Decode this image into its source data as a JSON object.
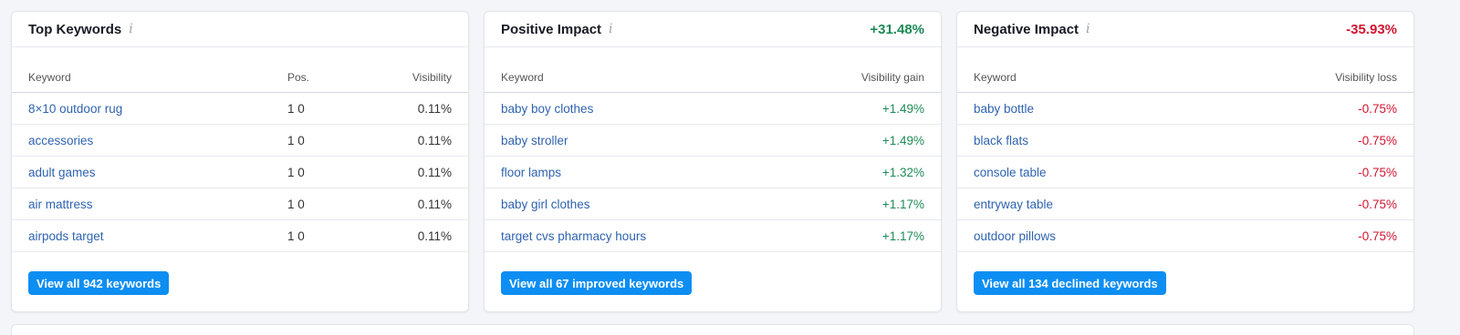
{
  "top": {
    "title": "Top Keywords",
    "info_icon": "i",
    "headers": {
      "keyword": "Keyword",
      "pos": "Pos.",
      "visibility": "Visibility"
    },
    "rows": [
      {
        "keyword": "8×10 outdoor rug",
        "pos": "1 0",
        "value": "0.11%"
      },
      {
        "keyword": "accessories",
        "pos": "1 0",
        "value": "0.11%"
      },
      {
        "keyword": "adult games",
        "pos": "1 0",
        "value": "0.11%"
      },
      {
        "keyword": "air mattress",
        "pos": "1 0",
        "value": "0.11%"
      },
      {
        "keyword": "airpods target",
        "pos": "1 0",
        "value": "0.11%"
      }
    ],
    "button": "View all 942 keywords"
  },
  "positive": {
    "title": "Positive Impact",
    "info_icon": "i",
    "delta": "+31.48%",
    "headers": {
      "keyword": "Keyword",
      "value": "Visibility gain"
    },
    "rows": [
      {
        "keyword": "baby boy clothes",
        "value": "+1.49%"
      },
      {
        "keyword": "baby stroller",
        "value": "+1.49%"
      },
      {
        "keyword": "floor lamps",
        "value": "+1.32%"
      },
      {
        "keyword": "baby girl clothes",
        "value": "+1.17%"
      },
      {
        "keyword": "target cvs pharmacy hours",
        "value": "+1.17%"
      }
    ],
    "button": "View all 67 improved keywords"
  },
  "negative": {
    "title": "Negative Impact",
    "info_icon": "i",
    "delta": "-35.93%",
    "headers": {
      "keyword": "Keyword",
      "value": "Visibility loss"
    },
    "rows": [
      {
        "keyword": "baby bottle",
        "value": "-0.75%"
      },
      {
        "keyword": "black flats",
        "value": "-0.75%"
      },
      {
        "keyword": "console table",
        "value": "-0.75%"
      },
      {
        "keyword": "entryway table",
        "value": "-0.75%"
      },
      {
        "keyword": "outdoor pillows",
        "value": "-0.75%"
      }
    ],
    "button": "View all 134 declined keywords"
  },
  "colors": {
    "accent": "#0d8ef2",
    "link": "#2f63b0",
    "positive": "#1d8a56",
    "negative": "#d1142f"
  }
}
